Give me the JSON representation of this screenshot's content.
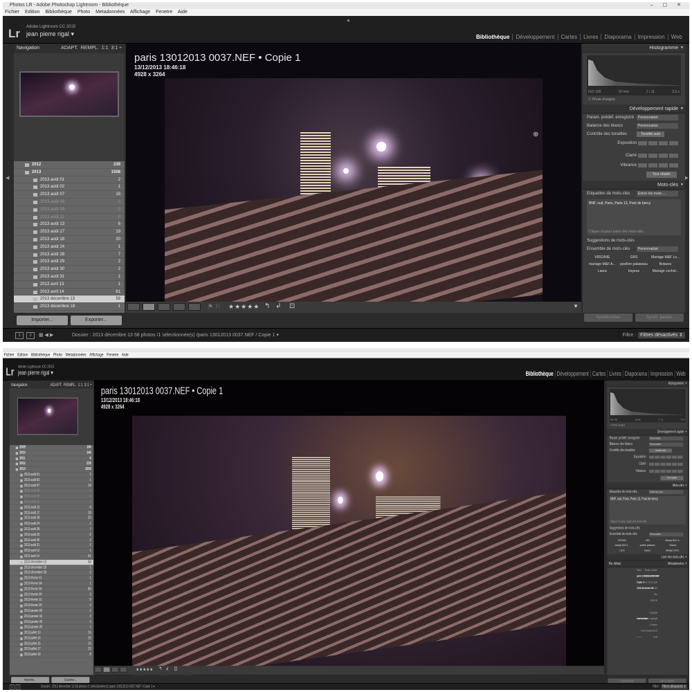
{
  "window": {
    "title": "Photos LR - Adobe Photoshop Lightroom - Bibliothèque",
    "controls": "– ▢ ✕"
  },
  "menu": [
    "Fichier",
    "Edition",
    "Bibliothèque",
    "Photo",
    "Metadonnées",
    "Affichage",
    "Fenetre",
    "Aide"
  ],
  "identity": {
    "logo": "Lr",
    "app_name": "Adobe Lightroom CC 2015",
    "user": "jean pierre rigal ▾"
  },
  "modules": [
    "Bibliothèque",
    "Développement",
    "Cartes",
    "Livres",
    "Diaporama",
    "Impression",
    "Web"
  ],
  "navigator": {
    "title": "Navigation",
    "opt1": "ADAPT.",
    "opt2": "REMPL.",
    "opt3": "1:1",
    "opt4": "3:1 ÷"
  },
  "folders_s1": [
    {
      "name": "2012",
      "count": "239",
      "type": "y"
    },
    {
      "name": "2013",
      "count": "1508",
      "type": "y"
    },
    {
      "name": "2013 août 01",
      "count": "2"
    },
    {
      "name": "2013 août 02",
      "count": "1"
    },
    {
      "name": "2013 août 07",
      "count": "18"
    },
    {
      "name": "2013 août 08",
      "count": "0",
      "dim": true
    },
    {
      "name": "2013 août 09",
      "count": "0",
      "dim": true
    },
    {
      "name": "2013 août 11",
      "count": "0",
      "dim": true
    },
    {
      "name": "2013 août 13",
      "count": "6"
    },
    {
      "name": "2013 août 17",
      "count": "19"
    },
    {
      "name": "2013 août 18",
      "count": "20"
    },
    {
      "name": "2013 août 24",
      "count": "1"
    },
    {
      "name": "2013 août 28",
      "count": "7"
    },
    {
      "name": "2013 août 29",
      "count": "2"
    },
    {
      "name": "2013 août 30",
      "count": "2"
    },
    {
      "name": "2013 août 31",
      "count": "1"
    },
    {
      "name": "2013 avril 13",
      "count": "1"
    },
    {
      "name": "2013 avril 14",
      "count": "81"
    },
    {
      "name": "2013 décembre 13",
      "count": "58",
      "sel": true
    },
    {
      "name": "2013 décembre 18",
      "count": "1"
    }
  ],
  "folders_s2": [
    {
      "name": "2009",
      "count": "166",
      "type": "y"
    },
    {
      "name": "2010",
      "count": "146",
      "type": "y"
    },
    {
      "name": "2011",
      "count": "6",
      "type": "y"
    },
    {
      "name": "2012",
      "count": "239",
      "type": "y"
    },
    {
      "name": "2013",
      "count": "1508",
      "type": "y"
    },
    {
      "name": "2013 août 01",
      "count": "2"
    },
    {
      "name": "2013 août 02",
      "count": "1"
    },
    {
      "name": "2013 août 07",
      "count": "18"
    },
    {
      "name": "2013 août 08",
      "count": "0",
      "dim": true
    },
    {
      "name": "2013 août 09",
      "count": "0",
      "dim": true
    },
    {
      "name": "2013 août 11",
      "count": "0",
      "dim": true
    },
    {
      "name": "2013 août 13",
      "count": "6"
    },
    {
      "name": "2013 août 17",
      "count": "19"
    },
    {
      "name": "2013 août 18",
      "count": "20"
    },
    {
      "name": "2013 août 24",
      "count": "1"
    },
    {
      "name": "2013 août 28",
      "count": "7"
    },
    {
      "name": "2013 août 29",
      "count": "2"
    },
    {
      "name": "2013 août 30",
      "count": "2"
    },
    {
      "name": "2013 août 31",
      "count": "1"
    },
    {
      "name": "2013 avril 13",
      "count": "1"
    },
    {
      "name": "2013 avril 14",
      "count": "81"
    },
    {
      "name": "2013 décembre 13",
      "count": "58",
      "sel": true
    },
    {
      "name": "2013 décembre 18",
      "count": "1"
    },
    {
      "name": "2013 décembre 28",
      "count": "2"
    },
    {
      "name": "2013 février 01",
      "count": "1"
    },
    {
      "name": "2013 février 04",
      "count": "1"
    },
    {
      "name": "2013 février 06",
      "count": "86"
    },
    {
      "name": "2013 février 09",
      "count": "3"
    },
    {
      "name": "2013 février 15",
      "count": "5"
    },
    {
      "name": "2013 février 26",
      "count": "3"
    },
    {
      "name": "2013 janvier 03",
      "count": "2"
    },
    {
      "name": "2013 janvier 16",
      "count": "2"
    },
    {
      "name": "2013 janvier 25",
      "count": "3"
    },
    {
      "name": "2013 janvier 26",
      "count": "1"
    },
    {
      "name": "2013 juillet 13",
      "count": "15"
    },
    {
      "name": "2013 juillet 14",
      "count": "15"
    },
    {
      "name": "2013 juillet 15",
      "count": "15"
    },
    {
      "name": "2013 juillet 17",
      "count": "22"
    },
    {
      "name": "2013 juillet 18",
      "count": "8"
    }
  ],
  "left_buttons": {
    "import": "Importer...",
    "export": "Exporter..."
  },
  "photo": {
    "title": "paris 13012013 0037.NEF  •  Copie 1",
    "date": "13/12/2013 18:46:18",
    "dims": "4928 x 3264"
  },
  "toolbar": {
    "stars": "★★★★★",
    "flag": "⚑ ⚐"
  },
  "histogram": {
    "title": "Histogramme",
    "iso": "ISO 100",
    "focal": "10 mm",
    "aperture": "ƒ / 11",
    "shutter": "2,5 s",
    "original": "☐ Photo d'origine"
  },
  "quick_dev": {
    "title": "Développement rapide",
    "preset_label": "Param. prédéf. enregistré",
    "preset_value": "Personnalisé",
    "wb_label": "Balance des blancs",
    "wb_value": "Personnalisé",
    "tone_label": "Contrôle des tonalités",
    "tone_btn": "Tonalité auto",
    "exposure": "Exposition",
    "clarity": "Clarté",
    "vibrance": "Vibrance",
    "reset": "Tout rétablir"
  },
  "keywords": {
    "title": "Mots-clés",
    "tag_label": "Etiquettes de mots-clés",
    "tag_value": "Entrer les mots-...",
    "content": "BNF, nuit, Paris, Paris 13, Pont de bercy",
    "hint": "Cliquer ici pour saisir des mots-clés",
    "suggestions": "Suggestions de mots-clés",
    "set_label": "Ensemble de mots-clés",
    "set_value": "Personnalisé",
    "set_items": [
      "VIRGINIE",
      "GRS",
      "Mariage M&F Lo...",
      "mariage M&F A...",
      "pavillon palaiseau",
      "Bolazec",
      "Laura",
      "bayeux",
      "Mariage cochol..."
    ]
  },
  "keyword_list": {
    "title": "Liste des mots-clés"
  },
  "metadata": {
    "title": "Métadonnées",
    "default_label": "Par défaut",
    "preset_label": "Param. prédéf.",
    "preset_value": "Sans",
    "rows": [
      {
        "k": "Nom du fichier",
        "v": "paris 13012013 0037.NEF"
      },
      {
        "k": "Nom de la copie",
        "v": "Copie 1"
      },
      {
        "k": "Dossier",
        "v": "2013 décembre 13"
      },
      {
        "k": "Titre",
        "v": ""
      },
      {
        "k": "Légende",
        "v": ""
      },
      {
        "k": "",
        "v": ""
      },
      {
        "k": "Copyright",
        "v": ""
      },
      {
        "k": "Etat du copyright",
        "v": "Indéterminé"
      },
      {
        "k": "Créateur",
        "v": ""
      },
      {
        "k": "Sous-emplacement",
        "v": ""
      },
      {
        "k": "Note",
        "v": "· · · · ·"
      }
    ]
  },
  "right_buttons": {
    "sync": "Synchroniser",
    "sync_params": "Synch. param."
  },
  "filmstrip": {
    "page1": "1",
    "page2": "2",
    "path": "Dossier : 2013 décembre 13     58 photos /1 sélectionnée(s) /paris 13012013 0037.NEF / Copie 1 ▾",
    "path_short": "Dossier : 2013 décembre 13",
    "filter_label": "Filtre :",
    "filter_value": "Filtres désactivés ⇕"
  },
  "colors": {
    "panel": "#3d3d3d",
    "background": "#2b2b2b",
    "selected_row": "#cfcfcf"
  }
}
